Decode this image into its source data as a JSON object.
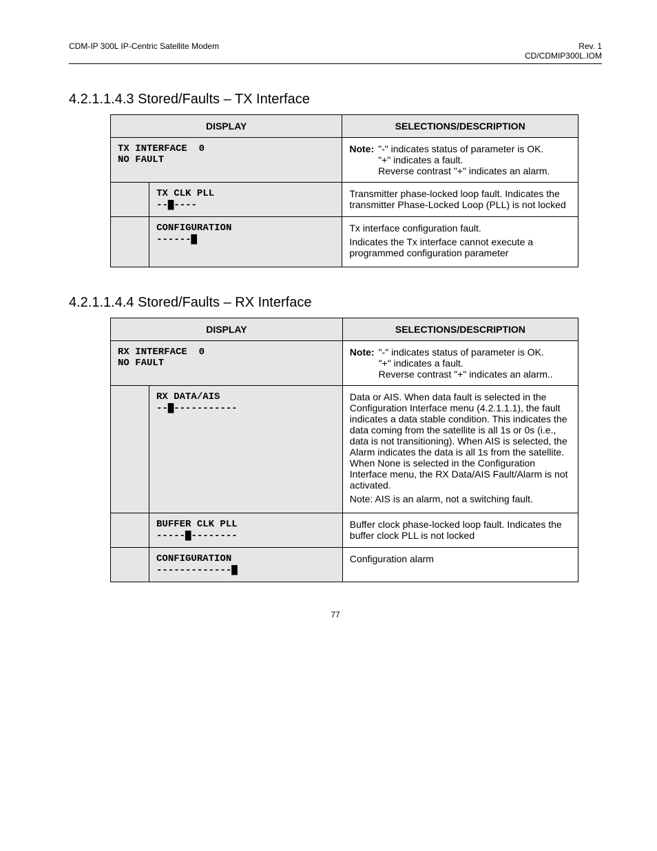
{
  "header": {
    "left": "CDM-IP 300L IP-Centric Satellite Modem",
    "right_line1": "Rev. 1",
    "right_line2": "CD/CDMIP300L.IOM"
  },
  "sections": [
    {
      "number": "4.2.1.1.4.3",
      "title": "Stored/Faults – TX Interface",
      "table_headers": {
        "c1": "DISPLAY",
        "c2": "SELECTIONS/DESCRIPTION"
      },
      "main_row": {
        "display": "TX INTERFACE  0\nNO FAULT",
        "note_label": "Note:",
        "note_lines": [
          "\"-\" indicates status of parameter is OK.",
          "\"+\" indicates a fault.",
          "Reverse contrast \"+\" indicates an alarm."
        ]
      },
      "rows": [
        {
          "display": "TX CLK PLL\n--▇----",
          "desc": "Transmitter phase-locked loop fault. Indicates the transmitter Phase-Locked Loop (PLL) is not locked"
        },
        {
          "display": "CONFIGURATION\n------▇",
          "desc_lines": [
            "Tx interface configuration fault.",
            "Indicates the Tx interface cannot execute a programmed configuration parameter"
          ]
        }
      ]
    },
    {
      "number": "4.2.1.1.4.4",
      "title": "Stored/Faults – RX Interface",
      "table_headers": {
        "c1": "DISPLAY",
        "c2": "SELECTIONS/DESCRIPTION"
      },
      "main_row": {
        "display": "RX INTERFACE  0\nNO FAULT",
        "note_label": "Note:",
        "note_lines": [
          "\"-\" indicates status of parameter is OK.",
          "\"+\" indicates a fault.",
          "Reverse contrast \"+\" indicates an alarm.."
        ]
      },
      "rows": [
        {
          "display": "RX DATA/AIS\n--▇-----------",
          "desc_lines": [
            "Data or AIS. When data fault is selected in the Configuration Interface menu (4.2.1.1.1), the fault indicates a data stable condition. This indicates the data coming from the satellite is all 1s or 0s (i.e., data is not transitioning). When AIS is selected, the Alarm indicates the data is all 1s from the satellite. When None is selected in the Configuration Interface menu, the RX Data/AIS Fault/Alarm is not activated.",
            "Note: AIS is an alarm, not a switching fault."
          ]
        },
        {
          "display": "BUFFER CLK PLL\n-----▇--------",
          "desc": "Buffer clock phase-locked loop fault. Indicates the buffer clock PLL is not locked"
        },
        {
          "display": "CONFIGURATION\n-------------▇",
          "desc": "Configuration alarm"
        }
      ]
    }
  ],
  "page_number": "77"
}
